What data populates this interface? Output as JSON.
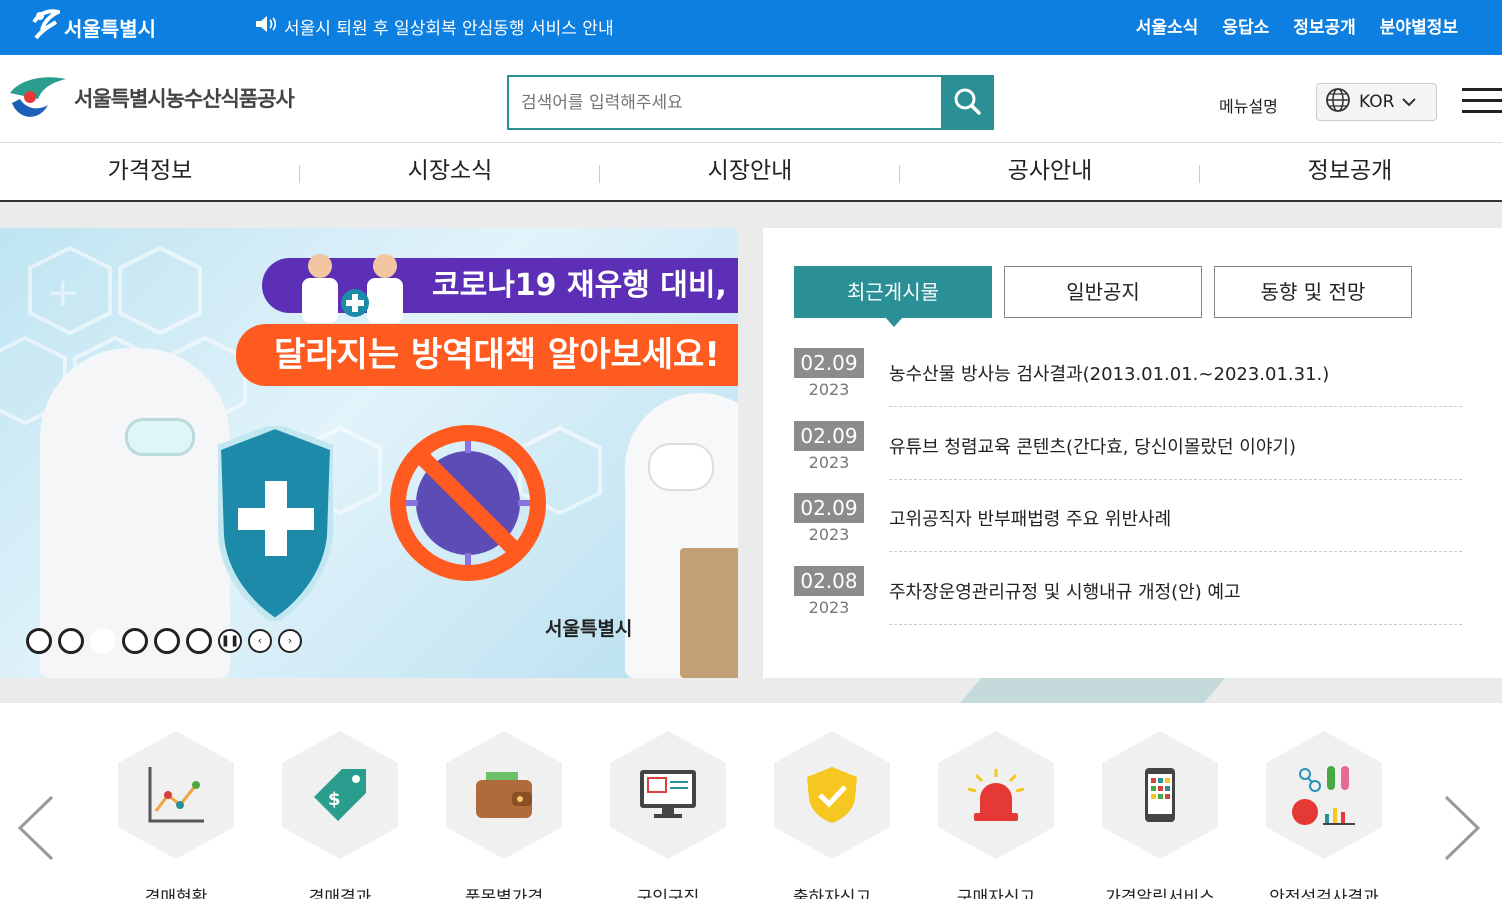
{
  "topbar": {
    "city_name": "서울특별시",
    "notice": "서울시 퇴원 후 일상회복 안심동행 서비스 안내",
    "links": [
      "서울소식",
      "응답소",
      "정보공개",
      "분야별정보"
    ]
  },
  "header": {
    "org_name": "서울특별시농수산식품공사",
    "search_placeholder": "검색어를 입력해주세요",
    "menu_desc": "메뉴설명",
    "language": "KOR"
  },
  "nav": [
    "가격정보",
    "시장소식",
    "시장안내",
    "공사안내",
    "정보공개"
  ],
  "banner": {
    "headline1": "코로나19 재유행 대비,",
    "headline2": "달라지는 방역대책 알아보세요!",
    "city_mark": "서울특별시",
    "slide_count": 6,
    "active_slide": 3
  },
  "board": {
    "tabs": [
      "최근게시물",
      "일반공지",
      "동향 및 전망"
    ],
    "active_tab": 0,
    "posts": [
      {
        "md": "02.09",
        "year": "2023",
        "title": "농수산물 방사능 검사결과(2013.01.01.~2023.01.31.)"
      },
      {
        "md": "02.09",
        "year": "2023",
        "title": "유튜브 청렴교육 콘텐츠(간다효, 당신이몰랐던 이야기)"
      },
      {
        "md": "02.09",
        "year": "2023",
        "title": "고위공직자 반부패법령 주요 위반사례"
      },
      {
        "md": "02.08",
        "year": "2023",
        "title": "주차장운영관리규정 및 시행내규 개정(안) 예고"
      }
    ]
  },
  "quick": {
    "items": [
      {
        "label": "경매현황",
        "icon": "line-chart-icon"
      },
      {
        "label": "경매결과",
        "icon": "price-tag-icon"
      },
      {
        "label": "품목별가격",
        "icon": "wallet-icon"
      },
      {
        "label": "구인구직",
        "icon": "monitor-icon"
      },
      {
        "label": "출하자신고",
        "icon": "shield-check-icon"
      },
      {
        "label": "구매자신고",
        "icon": "siren-icon"
      },
      {
        "label": "가격알림서비스",
        "icon": "smartphone-icon"
      },
      {
        "label": "안전성검사결과",
        "icon": "lab-test-icon"
      }
    ]
  },
  "colors": {
    "brand_blue": "#0d7fe0",
    "teal": "#2b8f96",
    "purple": "#5d2fb7",
    "orange": "#ff5a1f"
  }
}
